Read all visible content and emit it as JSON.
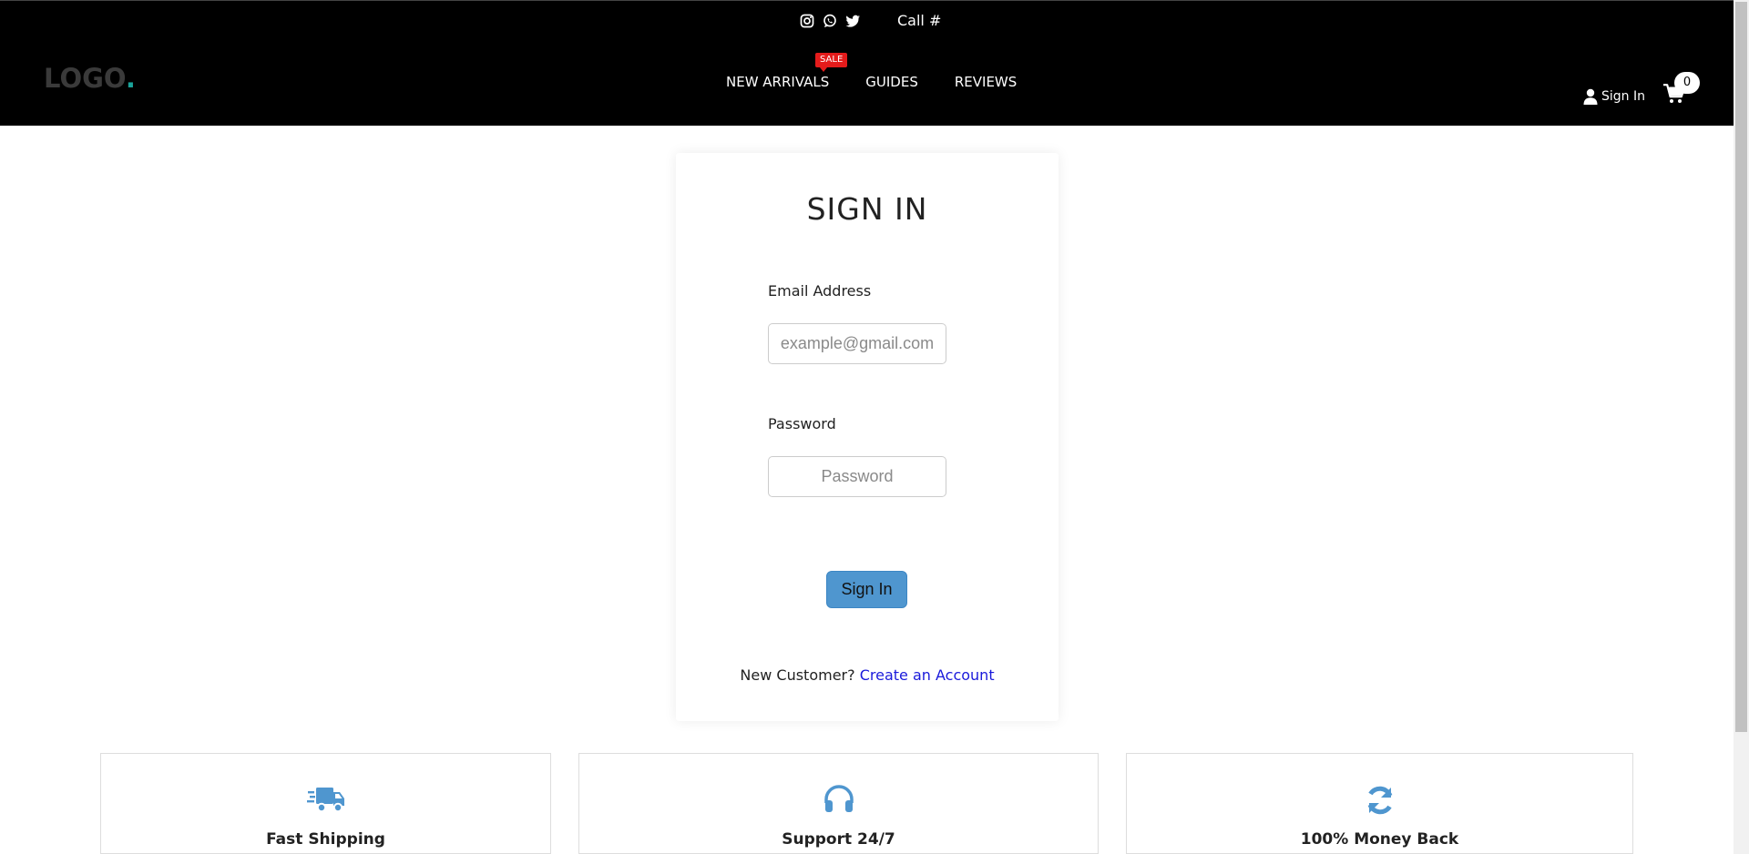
{
  "topbar": {
    "call_label": "Call #",
    "social_icons": [
      "instagram-icon",
      "whatsapp-icon",
      "twitter-icon"
    ]
  },
  "logo": {
    "text": "LOGO",
    "dot": "."
  },
  "nav": {
    "items": [
      {
        "label": "NEW ARRIVALS",
        "badge": "SALE"
      },
      {
        "label": "GUIDES"
      },
      {
        "label": "REVIEWS"
      }
    ]
  },
  "account": {
    "sign_in_label": "Sign In",
    "cart_count": "0"
  },
  "signin": {
    "title": "SIGN IN",
    "email_label": "Email Address",
    "email_placeholder": "example@gmail.com",
    "password_label": "Password",
    "password_placeholder": "Password",
    "submit_label": "Sign In",
    "new_customer_text": "New Customer?",
    "create_account_link": "Create an Account"
  },
  "features": [
    {
      "title": "Fast Shipping",
      "icon": "truck-icon"
    },
    {
      "title": "Support 24/7",
      "icon": "headphones-icon"
    },
    {
      "title": "100% Money Back",
      "icon": "refresh-icon"
    }
  ],
  "colors": {
    "header_bg": "#000000",
    "accent": "#4f96cf",
    "sale": "#e41b1b",
    "link": "#1a1adb",
    "logo_dot": "#1aa39a"
  }
}
